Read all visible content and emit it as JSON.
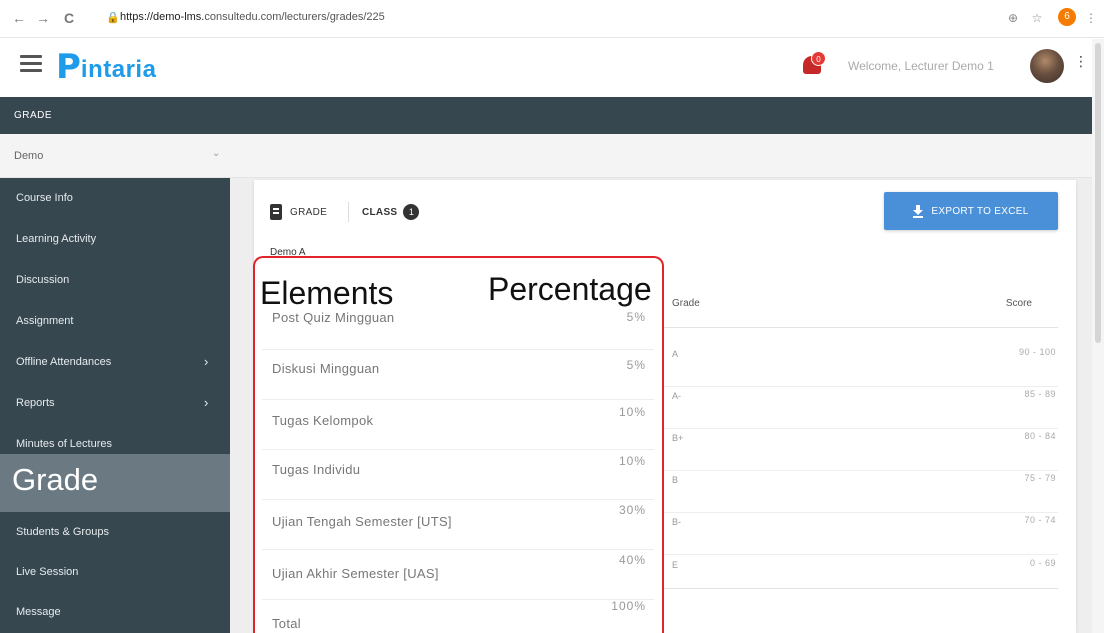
{
  "browser": {
    "back": "←",
    "forward": "→",
    "reload": "C",
    "lock": "🔒",
    "url_host": "https://demo-lms.",
    "url_rest": "consultedu.com/lecturers/grades/225",
    "zoom_icon": "⊕",
    "star_icon": "☆",
    "extension_badge": "6",
    "menu_icon": "⋮"
  },
  "header": {
    "logo_mark": "P",
    "logo_text": "intaria",
    "notification_badge": "0",
    "welcome_text": "Welcome, Lecturer Demo 1",
    "menu_icon": "⋮"
  },
  "grade_bar": {
    "title": "GRADE"
  },
  "course_select": {
    "value": "Demo",
    "chevron": "⌄"
  },
  "sidebar": {
    "items": [
      {
        "label": "Course Info",
        "chevron": ""
      },
      {
        "label": "Learning Activity",
        "chevron": ""
      },
      {
        "label": "Discussion",
        "chevron": ""
      },
      {
        "label": "Assignment",
        "chevron": ""
      },
      {
        "label": "Offline Attendances",
        "chevron": "›"
      },
      {
        "label": "Reports",
        "chevron": "›"
      },
      {
        "label": "Minutes of Lectures",
        "chevron": ""
      },
      {
        "label": "Grade",
        "chevron": ""
      },
      {
        "label": "Students & Groups",
        "chevron": ""
      },
      {
        "label": "Live Session",
        "chevron": ""
      },
      {
        "label": "Message",
        "chevron": ""
      }
    ]
  },
  "tabs": {
    "grade_label": "GRADE",
    "class_label": "CLASS",
    "class_count": "1"
  },
  "export_button": {
    "label": "EXPORT TO EXCEL"
  },
  "class_name": "Demo A",
  "elements_table": {
    "header_elements": "Elements",
    "header_percentage": "Percentage",
    "rows": [
      {
        "name": "Post Quiz Mingguan",
        "percentage": "5%"
      },
      {
        "name": "Diskusi Mingguan",
        "percentage": "5%"
      },
      {
        "name": "Tugas Kelompok",
        "percentage": "10%"
      },
      {
        "name": "Tugas Individu",
        "percentage": "10%"
      },
      {
        "name": "Ujian Tengah Semester [UTS]",
        "percentage": "30%"
      },
      {
        "name": "Ujian Akhir Semester [UAS]",
        "percentage": "40%"
      },
      {
        "name": "Total",
        "percentage": "100%"
      }
    ]
  },
  "grade_scale": {
    "header_grade": "Grade",
    "header_score": "Score",
    "rows": [
      {
        "grade": "A",
        "score": "90 - 100"
      },
      {
        "grade": "A-",
        "score": "85 - 89"
      },
      {
        "grade": "B+",
        "score": "80 - 84"
      },
      {
        "grade": "B",
        "score": "75 - 79"
      },
      {
        "grade": "B-",
        "score": "70 - 74"
      },
      {
        "grade": "E",
        "score": "0 - 69"
      }
    ]
  },
  "colors": {
    "sidebar_bg": "#37474f",
    "accent_blue": "#4a90d9",
    "logo_blue": "#1e9be9",
    "highlight_red": "#e0242a"
  }
}
